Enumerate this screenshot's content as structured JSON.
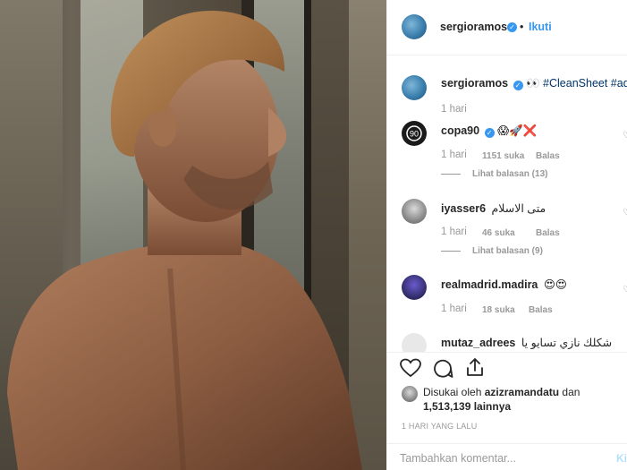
{
  "header": {
    "username": "sergioramos",
    "dot": "•",
    "follow_label": "Ikuti"
  },
  "caption": {
    "username": "sergioramos",
    "text": "👀 #CleanSheet #ad",
    "time": "1 hari"
  },
  "comments": [
    {
      "username": "copa90",
      "verified": true,
      "text": "😱🚀❌",
      "time": "1 hari",
      "likes": "1151 suka",
      "reply": "Balas",
      "view_replies": "Lihat balasan (13)"
    },
    {
      "username": "iyasser6",
      "verified": false,
      "text": "متى الاسلام",
      "time": "1 hari",
      "likes": "46 suka",
      "reply": "Balas",
      "view_replies": "Lihat balasan (9)"
    },
    {
      "username": "realmadrid.madira",
      "verified": false,
      "text": "😍😍",
      "time": "1 hari",
      "likes": "18 suka",
      "reply": "Balas"
    },
    {
      "username": "mutaz_adrees",
      "verified": false,
      "text": "شكلك نازي تسايو يا"
    }
  ],
  "likes": {
    "prefix": "Disukai oleh",
    "liker": "azizramandatu",
    "and": "dan",
    "count": "1,513,139 lainnya"
  },
  "time_ago": "1 HARI YANG LALU",
  "comment_box": {
    "placeholder": "Tambahkan komentar...",
    "post_label": "Ki"
  },
  "colors": {
    "accent": "#3897f0",
    "hashtag": "#003569",
    "muted": "#999999"
  }
}
